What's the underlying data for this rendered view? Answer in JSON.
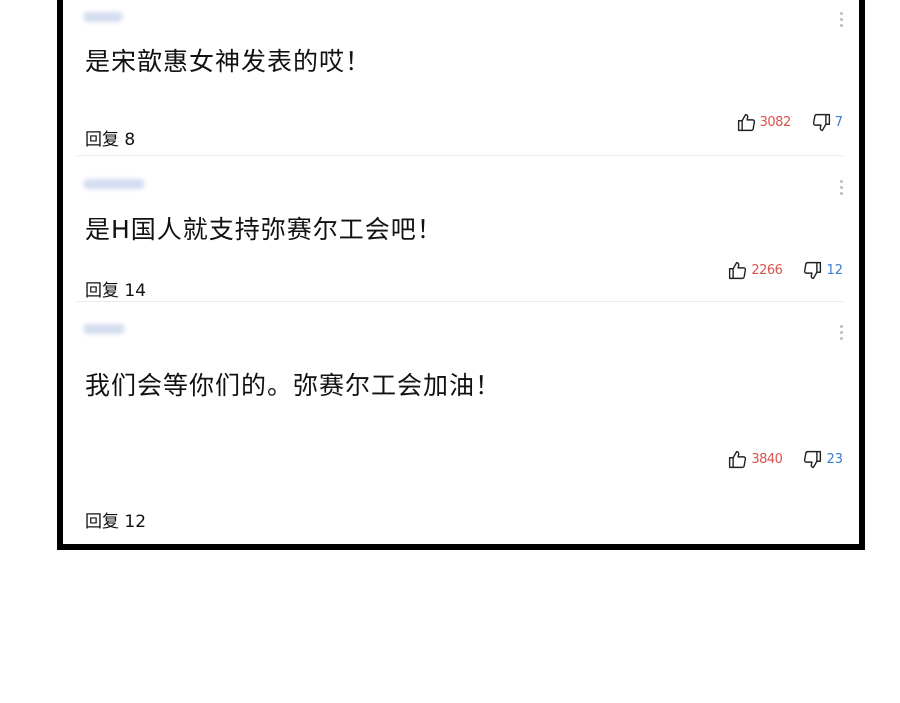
{
  "comments": [
    {
      "text": "是宋歆惠女神发表的哎！",
      "reply": "回复 8",
      "likes": "3082",
      "dislikes": "7"
    },
    {
      "text": "是H国人就支持弥赛尔工会吧！",
      "reply": "回复 14",
      "likes": "2266",
      "dislikes": "12"
    },
    {
      "text": "我们会等你们的。弥赛尔工会加油！",
      "reply": "回复 12",
      "likes": "3840",
      "dislikes": "23"
    }
  ],
  "icons": {
    "like": "thumbs-up-icon",
    "dislike": "thumbs-down-icon",
    "more": "more-vertical-icon"
  },
  "colors": {
    "like_count": "#d9534f",
    "dislike_count": "#3b7bd4",
    "border": "#000000"
  }
}
